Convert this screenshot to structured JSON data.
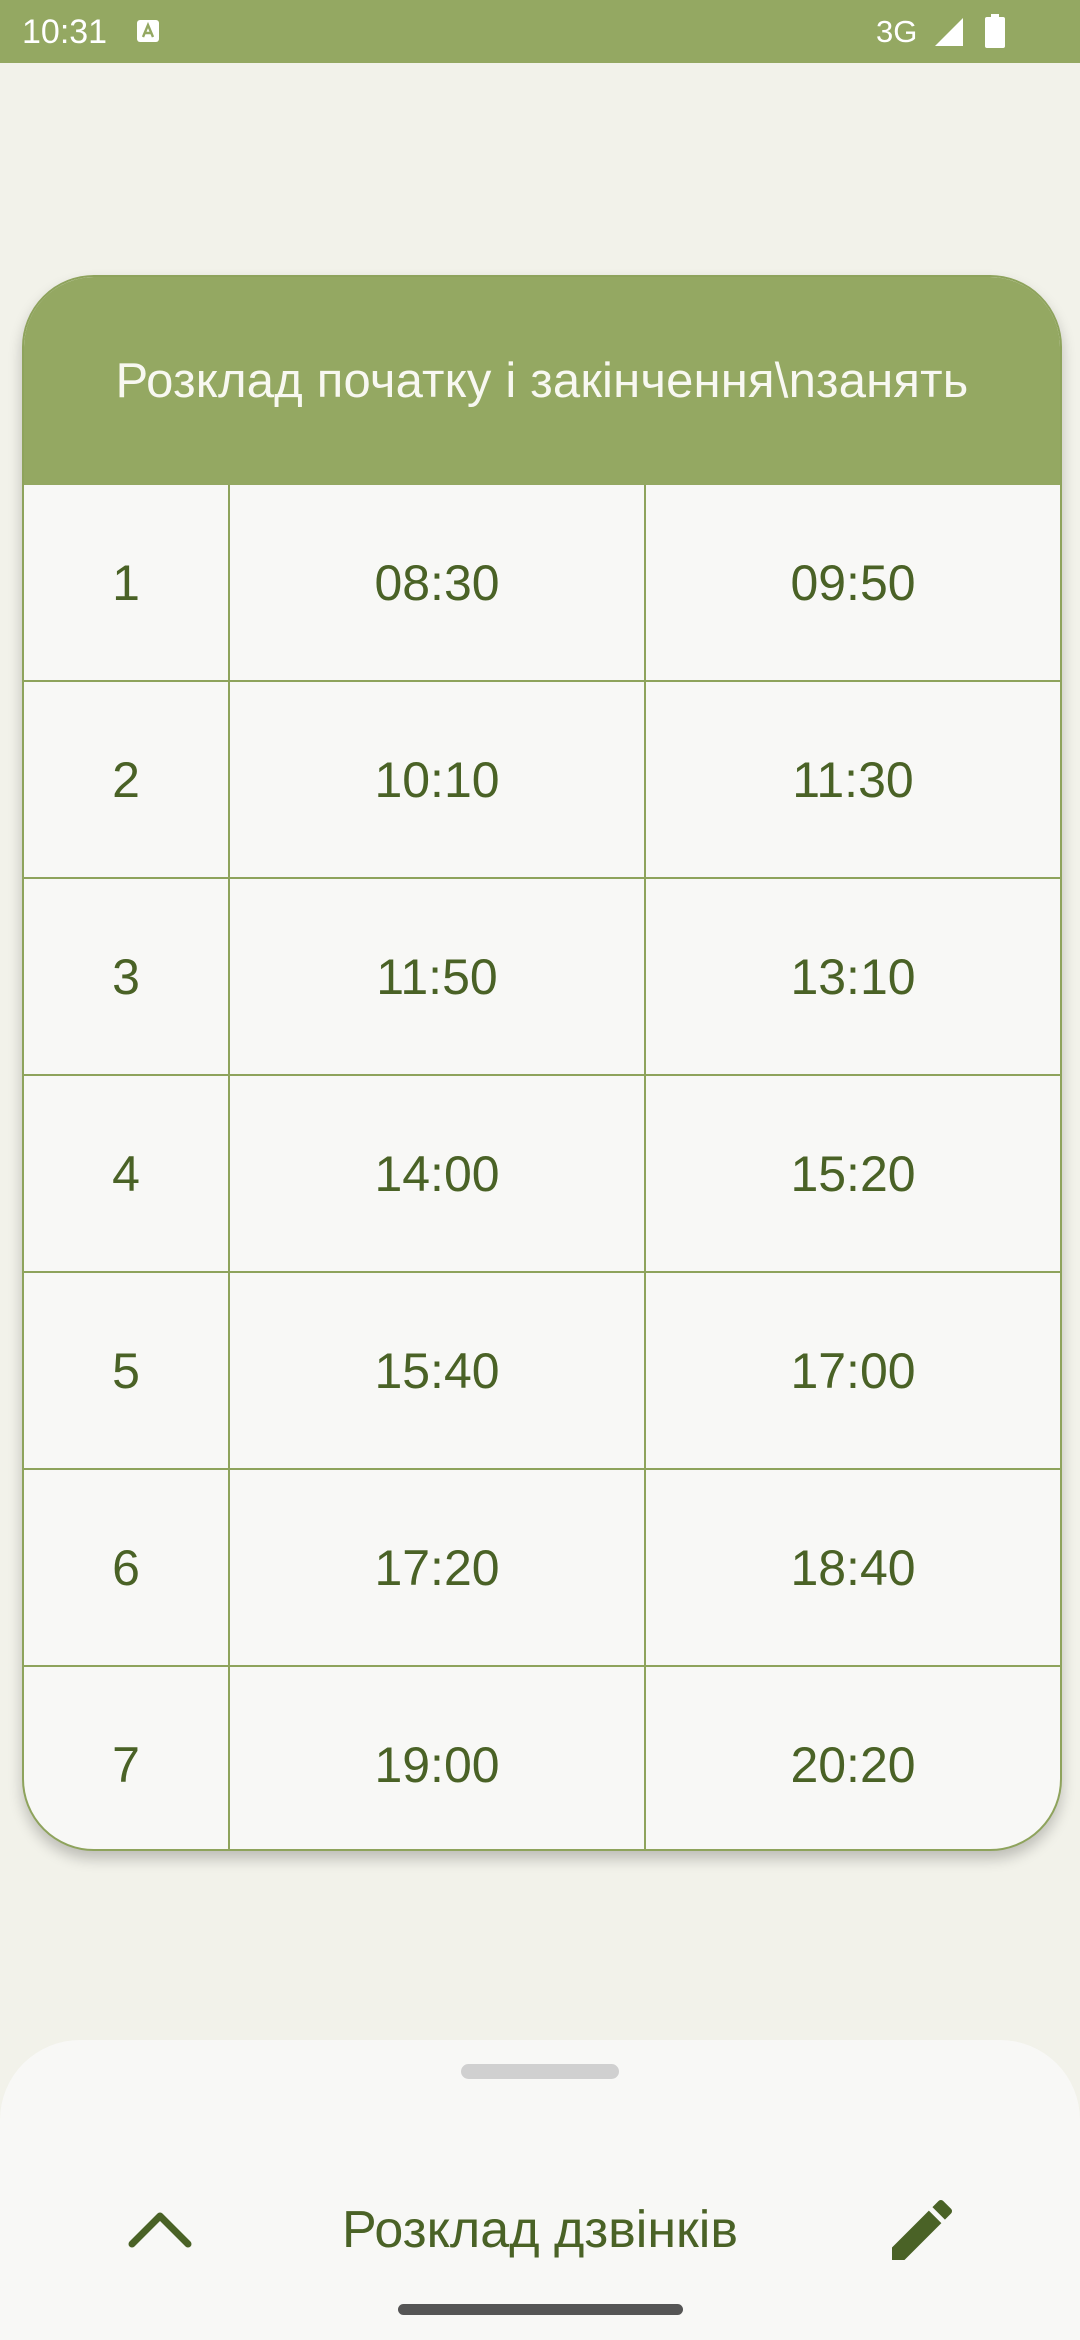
{
  "status_bar": {
    "time": "10:31",
    "network": "3G",
    "icons": [
      "keyboard-a-icon",
      "signal-icon",
      "battery-icon"
    ]
  },
  "card": {
    "title": "Розклад початку і закінчення\\nзанять",
    "rows": [
      {
        "num": "1",
        "start": "08:30",
        "end": "09:50"
      },
      {
        "num": "2",
        "start": "10:10",
        "end": "11:30"
      },
      {
        "num": "3",
        "start": "11:50",
        "end": "13:10"
      },
      {
        "num": "4",
        "start": "14:00",
        "end": "15:20"
      },
      {
        "num": "5",
        "start": "15:40",
        "end": "17:00"
      },
      {
        "num": "6",
        "start": "17:20",
        "end": "18:40"
      },
      {
        "num": "7",
        "start": "19:00",
        "end": "20:20"
      }
    ]
  },
  "bottom_sheet": {
    "title": "Розклад дзвінків",
    "icons": [
      "chevron-up-icon",
      "edit-pencil-icon"
    ]
  },
  "colors": {
    "accent": "#94a862",
    "text_green": "#4a6226",
    "border": "#8ea35c",
    "background": "#f2f2ea",
    "surface": "#f8f8f6"
  }
}
